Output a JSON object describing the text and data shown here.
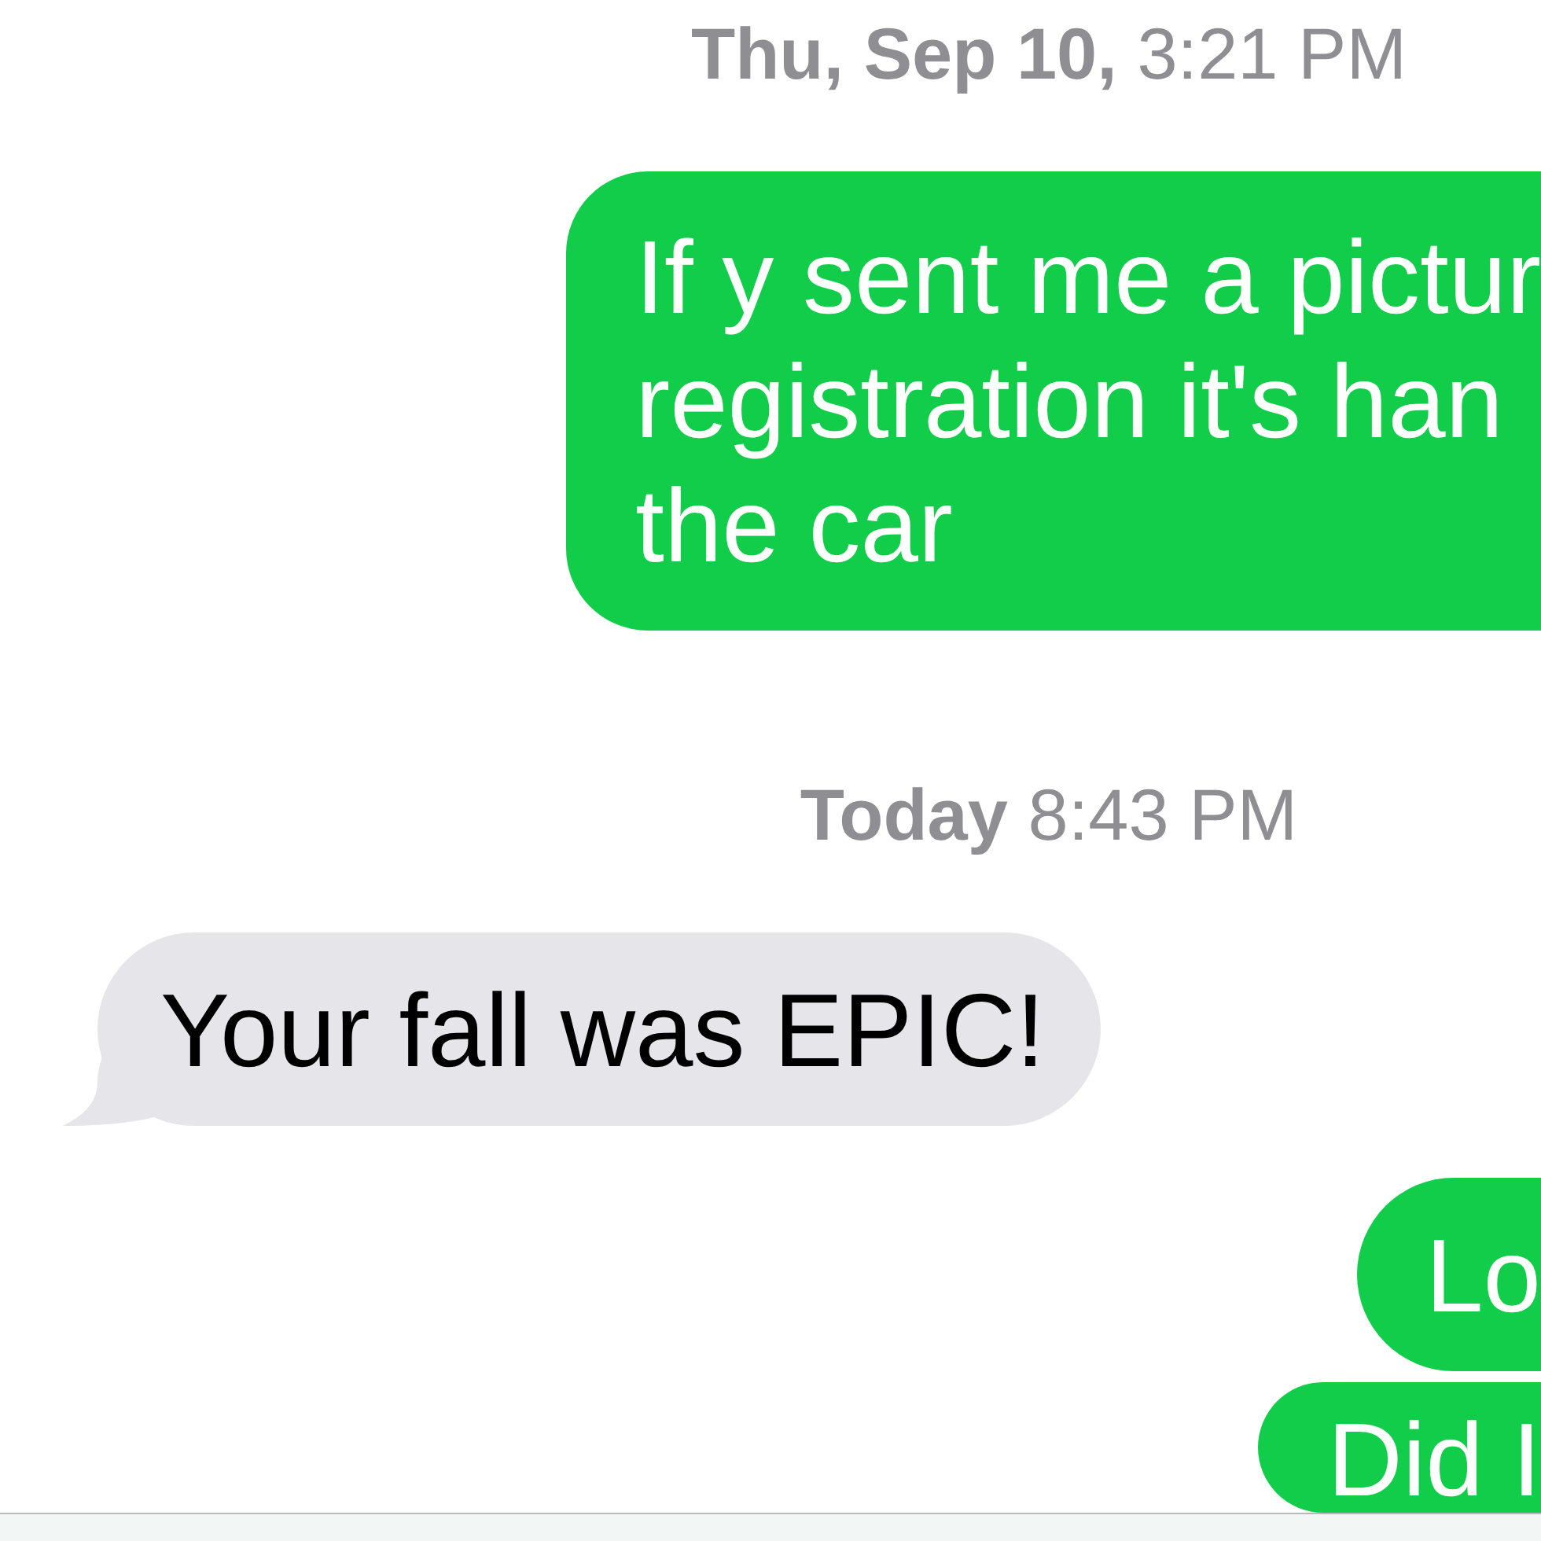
{
  "messages": [
    {
      "kind": "timestamp",
      "text": "**Thu, Sep 10,** 3:21 PM"
    },
    {
      "kind": "sent",
      "lines": [
        "If y sent me a pictur",
        "registration it's han",
        "the car"
      ]
    },
    {
      "kind": "timestamp",
      "text": "**Today** 8:43 PM"
    },
    {
      "kind": "received",
      "lines": [
        "Your fall was EPIC!"
      ]
    },
    {
      "kind": "sent",
      "lines": [
        "Lo"
      ]
    },
    {
      "kind": "sent",
      "lines": [
        "Did I"
      ]
    }
  ]
}
